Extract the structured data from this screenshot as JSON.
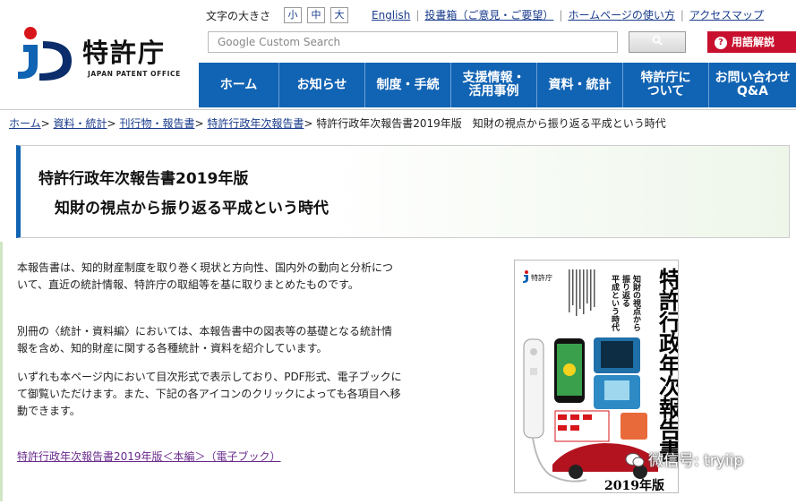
{
  "header": {
    "logo_text": "特許庁",
    "logo_sub": "JAPAN PATENT OFFICE",
    "font_size_label": "文字の大きさ",
    "font_sizes": [
      "小",
      "中",
      "大"
    ],
    "top_links": [
      "English",
      "投書箱（ご意見・ご要望）",
      "ホームページの使い方",
      "アクセスマップ"
    ],
    "search_placeholder": "Google Custom Search",
    "glossary_label": "用語解説"
  },
  "nav": {
    "items": [
      {
        "label": "ホーム"
      },
      {
        "label": "お知らせ"
      },
      {
        "label": "制度・手続"
      },
      {
        "label": "支援情報・\n活用事例"
      },
      {
        "label": "資料・統計"
      },
      {
        "label": "特許庁に\nついて"
      },
      {
        "label": "お問い合わせ\nQ&A"
      }
    ]
  },
  "breadcrumb": {
    "links": [
      "ホーム",
      "資料・統計",
      "刊行物・報告書",
      "特許行政年次報告書"
    ],
    "separator": ">",
    "current": "特許行政年次報告書2019年版　知財の視点から振り返る平成という時代"
  },
  "page": {
    "title_line1": "特許行政年次報告書2019年版",
    "title_line2": "知財の視点から振り返る平成という時代",
    "paragraphs": [
      "本報告書は、知的財産制度を取り巻く現状と方向性、国内外の動向と分析について、直近の統計情報、特許庁の取組等を基に取りまとめたものです。",
      "別冊の〈統計・資料編〉においては、本報告書中の図表等の基礎となる統計情報を含め、知的財産に関する各種統計・資料を紹介しています。",
      "いずれも本ページ内において目次形式で表示しており、PDF形式、電子ブックにて御覧いただけます。また、下記の各アイコンのクリックによっても各項目へ移動できます。"
    ],
    "ebook_link": "特許行政年次報告書2019年版＜本編＞（電子ブック）"
  },
  "cover": {
    "publisher": "特許庁",
    "title_vertical": "特許行政年次報告書",
    "subtitle_vertical": [
      "知財の視点から",
      "振り返る",
      "平成という時代"
    ],
    "year": "2019年版"
  },
  "watermark": {
    "text": "微信号: tryiip"
  },
  "colors": {
    "nav_blue": "#1163b3",
    "link_blue": "#1a3c8c",
    "glossary_red": "#c8102e",
    "visited_link": "#6a2a8c"
  }
}
